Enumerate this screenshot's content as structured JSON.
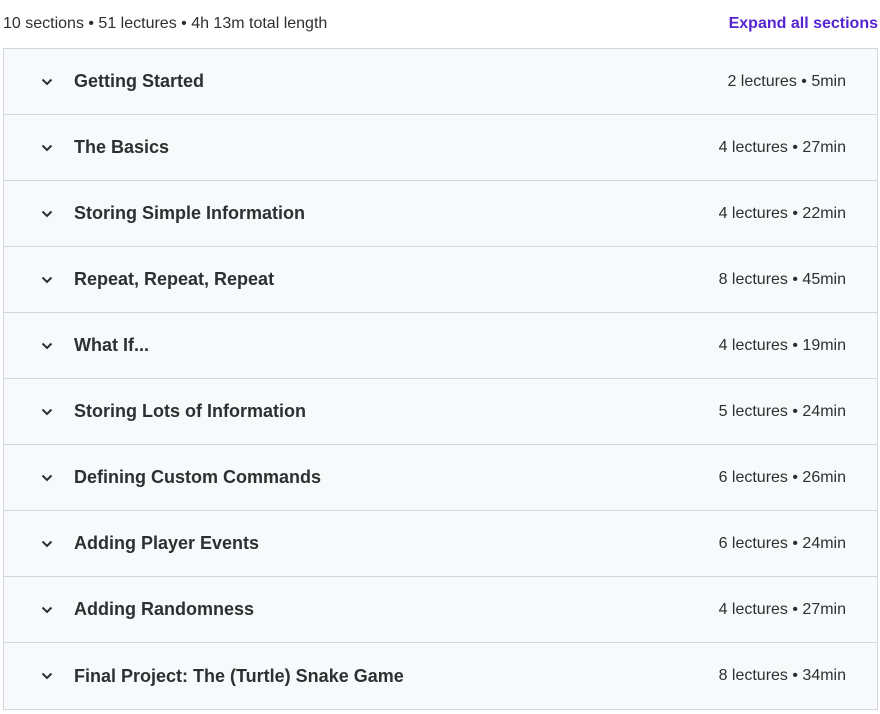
{
  "summary": {
    "text": "10 sections • 51 lectures • 4h 13m total length",
    "expand_label": "Expand all sections"
  },
  "colors": {
    "accent": "#5624d0",
    "row_bg": "#f7f9fa",
    "border": "#d1d7dc",
    "text": "#2d2f31"
  },
  "sections": [
    {
      "title": "Getting Started",
      "meta": "2 lectures • 5min",
      "icon": "chevron-down-icon"
    },
    {
      "title": "The Basics",
      "meta": "4 lectures • 27min",
      "icon": "chevron-down-icon"
    },
    {
      "title": "Storing Simple Information",
      "meta": "4 lectures • 22min",
      "icon": "chevron-down-icon"
    },
    {
      "title": "Repeat, Repeat, Repeat",
      "meta": "8 lectures • 45min",
      "icon": "chevron-down-icon"
    },
    {
      "title": "What If...",
      "meta": "4 lectures • 19min",
      "icon": "chevron-down-icon"
    },
    {
      "title": "Storing Lots of Information",
      "meta": "5 lectures • 24min",
      "icon": "chevron-down-icon"
    },
    {
      "title": "Defining Custom Commands",
      "meta": "6 lectures • 26min",
      "icon": "chevron-down-icon"
    },
    {
      "title": "Adding Player Events",
      "meta": "6 lectures • 24min",
      "icon": "chevron-down-icon"
    },
    {
      "title": "Adding Randomness",
      "meta": "4 lectures • 27min",
      "icon": "chevron-down-icon"
    },
    {
      "title": "Final Project: The (Turtle) Snake Game",
      "meta": "8 lectures • 34min",
      "icon": "chevron-down-icon"
    }
  ]
}
